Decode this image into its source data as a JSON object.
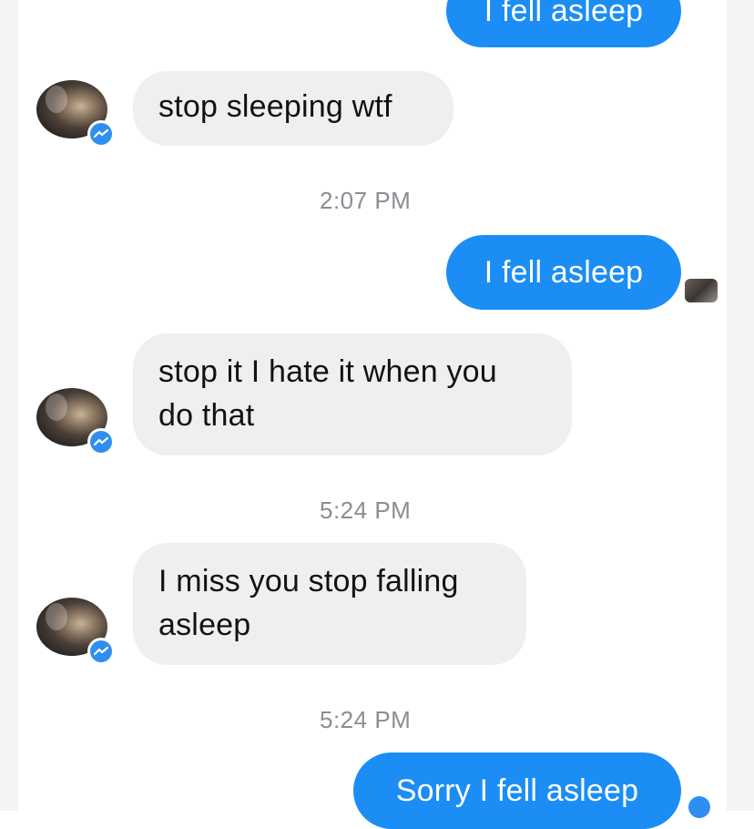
{
  "messages": [
    {
      "direction": "outgoing",
      "text": "I fell asleep"
    },
    {
      "direction": "incoming",
      "text": "stop sleeping wtf"
    },
    {
      "direction": "timestamp",
      "text": "2:07 PM"
    },
    {
      "direction": "outgoing",
      "text": "I fell asleep"
    },
    {
      "direction": "incoming",
      "line1": "stop it I hate it when you",
      "line2": "do that"
    },
    {
      "direction": "timestamp",
      "text": "5:24 PM"
    },
    {
      "direction": "incoming",
      "line1": "I miss you stop falling",
      "line2": "asleep"
    },
    {
      "direction": "timestamp",
      "text": "5:24 PM"
    },
    {
      "direction": "outgoing",
      "text": "Sorry I fell asleep"
    }
  ],
  "colors": {
    "outgoing_bubble": "#1b8df5",
    "incoming_bubble": "#eeeff1",
    "timestamp_text": "#8a8d93",
    "messenger_badge": "#2f8ff0"
  },
  "icons": {
    "sender_avatar": "avatar",
    "badge": "messenger-badge-icon",
    "seen": "read-receipt-avatar"
  }
}
